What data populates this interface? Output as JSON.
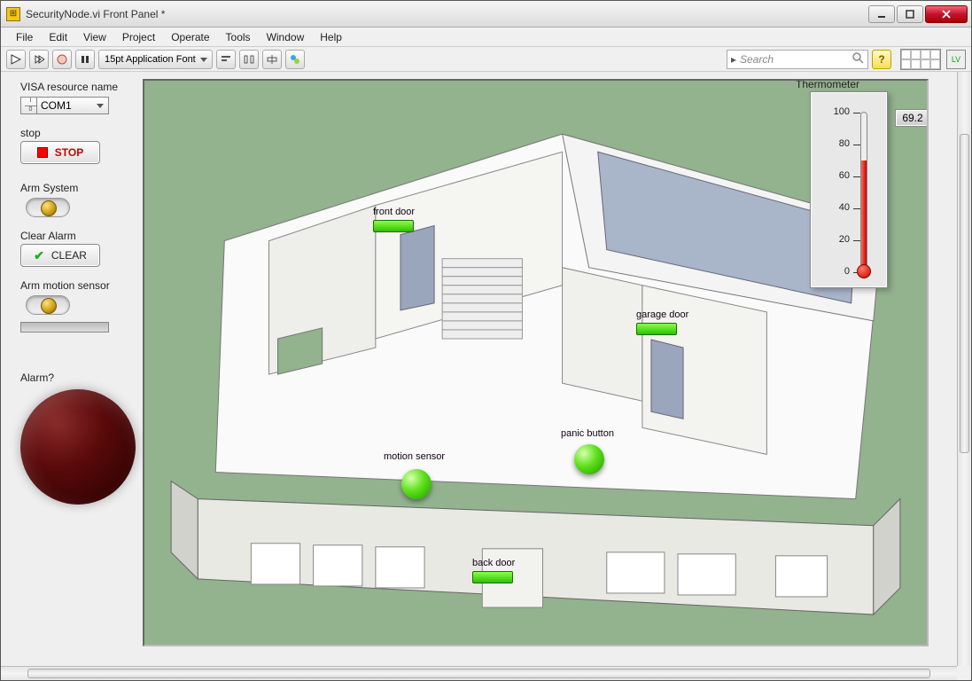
{
  "window": {
    "title": "SecurityNode.vi Front Panel *"
  },
  "menu": [
    "File",
    "Edit",
    "View",
    "Project",
    "Operate",
    "Tools",
    "Window",
    "Help"
  ],
  "toolbar": {
    "font": "15pt Application Font",
    "search_placeholder": "Search"
  },
  "controls": {
    "visa_label": "VISA resource name",
    "visa_value": "COM1",
    "stop_label": "stop",
    "stop_button": "STOP",
    "arm_label": "Arm System",
    "clear_label": "Clear Alarm",
    "clear_button": "CLEAR",
    "arm_motion_label": "Arm motion sensor",
    "alarm_label": "Alarm?"
  },
  "sensors": {
    "front_door": "front door",
    "garage_door": "garage door",
    "back_door": "back door",
    "motion_sensor": "motion sensor",
    "panic_button": "panic button"
  },
  "thermometer": {
    "title": "Thermometer",
    "ticks": [
      "100",
      "80",
      "60",
      "40",
      "20",
      "0"
    ],
    "value": "69.2",
    "fill_pct": 69.2
  }
}
